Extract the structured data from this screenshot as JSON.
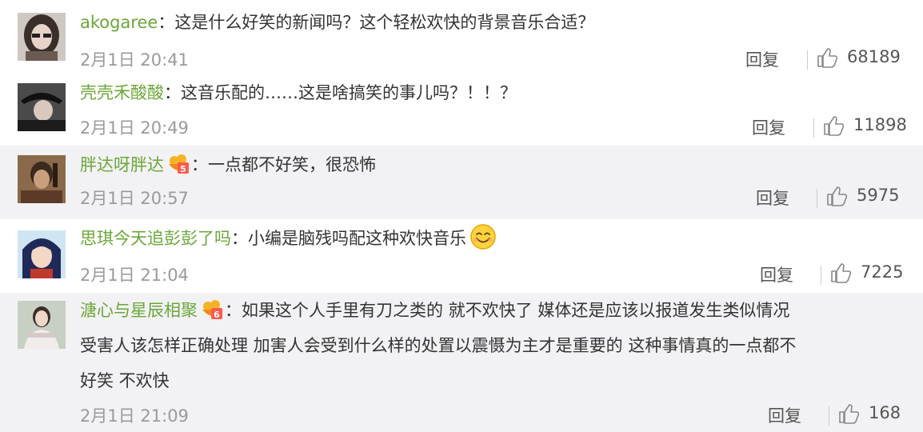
{
  "comments": [
    {
      "user": "akogaree",
      "colon": "：",
      "text": "这是什么好笑的新闻吗？这个轻松欢快的背景音乐合适？",
      "time": "2月1日 20:41",
      "reply_label": "回复",
      "likes": "68189",
      "avatar_icon": "avatar-portrait-woman",
      "has_badge": false
    },
    {
      "user": "壳壳禾酸酸",
      "colon": "：",
      "text": "这音乐配的……这是啥搞笑的事儿吗？！！？",
      "time": "2月1日 20:49",
      "reply_label": "回复",
      "likes": "11898",
      "avatar_icon": "avatar-portrait-hat",
      "has_badge": false
    },
    {
      "user": "胖达呀胖达",
      "colon": "：",
      "text": "一点都不好笑，很恐怖",
      "time": "2月1日 20:57",
      "reply_label": "回复",
      "likes": "5975",
      "avatar_icon": "avatar-portrait-man",
      "has_badge": true,
      "badge_icon": "vip-level-badge-icon"
    },
    {
      "user": "思琪今天追彭彭了吗",
      "colon": "：",
      "text": "小编是脑残吗配这种欢快音乐",
      "time": "2月1日 21:04",
      "reply_label": "回复",
      "likes": "7225",
      "avatar_icon": "avatar-anime-girl",
      "has_badge": false,
      "emoji_icon": "smile-emoji-icon"
    },
    {
      "user": "溏心与星辰相聚",
      "colon": "：",
      "text_line1": "如果这个人手里有刀之类的 就不欢快了 媒体还是应该以报道发生类似情况",
      "text_line2": "受害人该怎样正确处理 加害人会受到什么样的处置以震慑为主才是重要的 这种事情真的一点都不",
      "text_line3": "好笑 不欢快",
      "time": "2月1日 21:09",
      "reply_label": "回复",
      "likes": "168",
      "avatar_icon": "avatar-portrait-woman-dress",
      "has_badge": true,
      "badge_icon": "vip-level-badge-icon"
    }
  ],
  "colors": {
    "username": "#6ba638",
    "text": "#333333",
    "meta": "#9a9a9a",
    "alt_background": "#f2f2f5"
  }
}
